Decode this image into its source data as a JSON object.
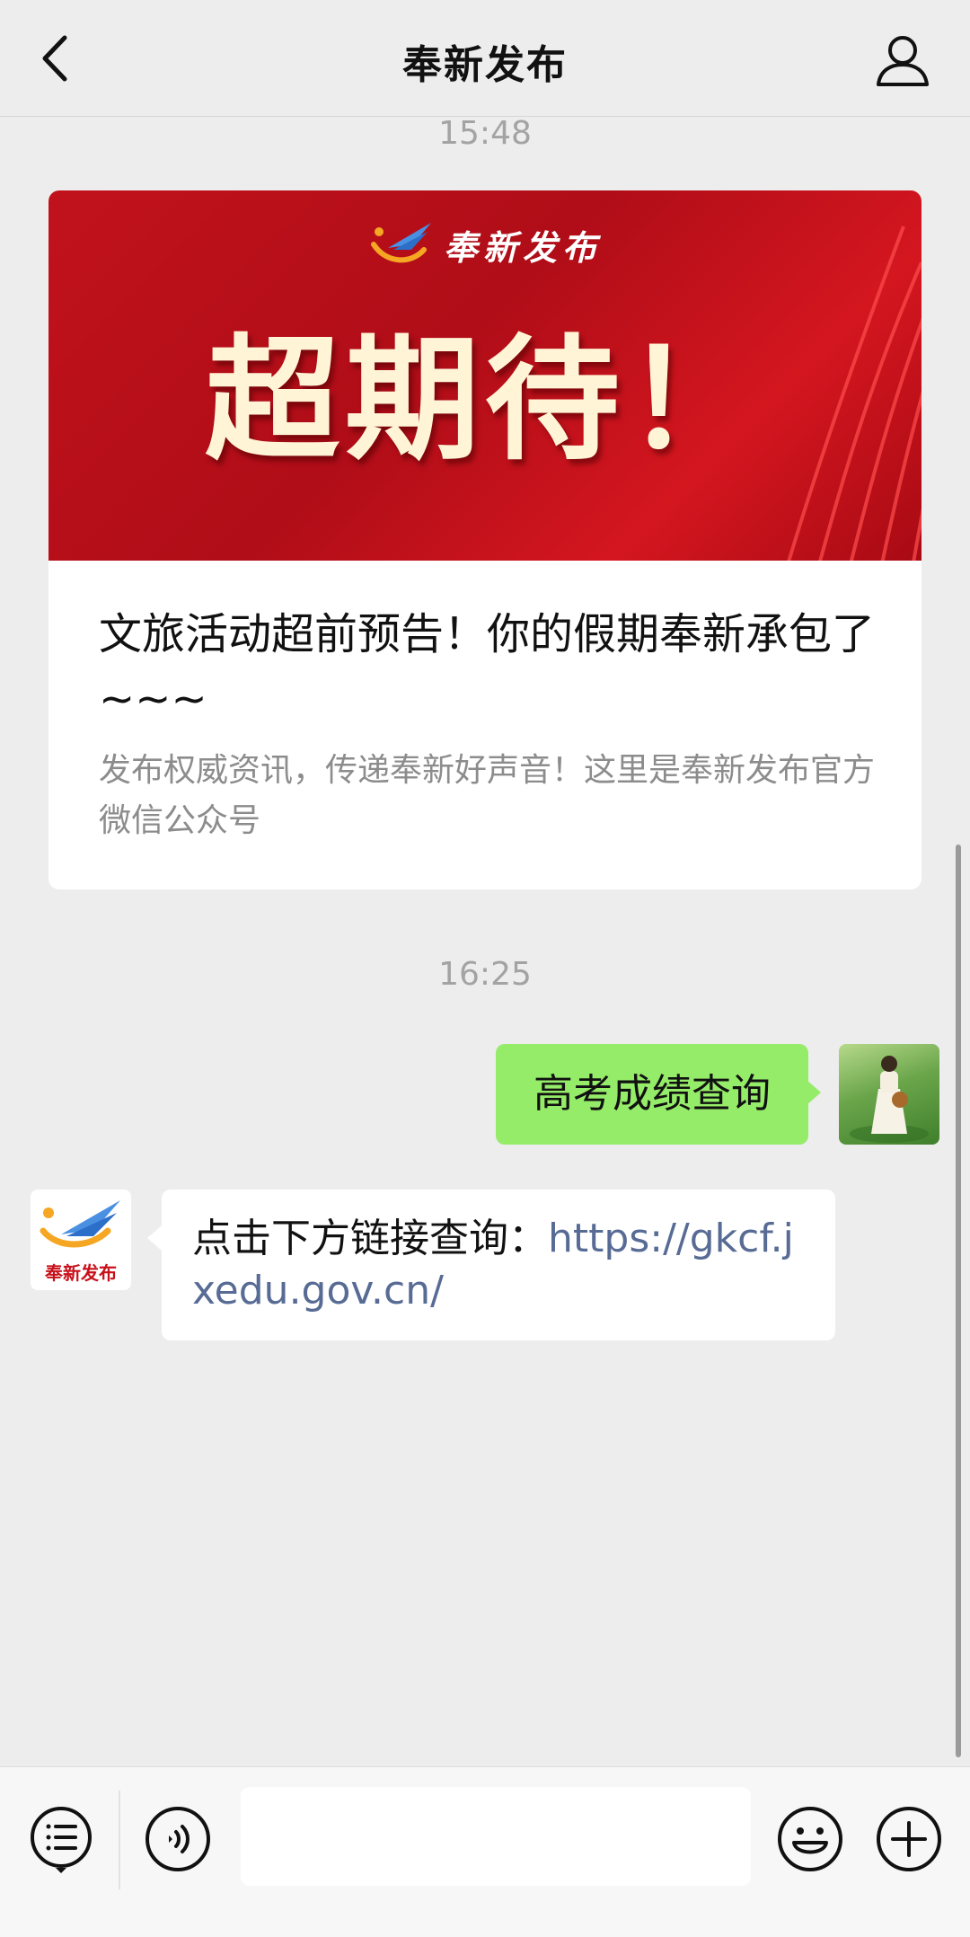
{
  "header": {
    "title": "奉新发布"
  },
  "messages": {
    "time_1": "15:48",
    "time_2": "16:25",
    "article": {
      "banner_brand": "奉新发布",
      "banner_headline": "超期待！",
      "title": "文旅活动超前预告！你的假期奉新承包了~~~",
      "description": "发布权威资讯，传递奉新好声音！这里是奉新发布官方微信公众号"
    },
    "sent": {
      "text": "高考成绩查询"
    },
    "received": {
      "text": "点击下方链接查询：",
      "link": "https://gkcf.jxedu.gov.cn/",
      "avatar_text": "奉新发布"
    }
  },
  "toolbar": {
    "input_value": ""
  },
  "colors": {
    "background": "#ededed",
    "sent_bubble": "#95ec69",
    "link": "#576b95",
    "banner_red": "#c1121c"
  },
  "icons": [
    "back-icon",
    "profile-icon",
    "menu-list-icon",
    "voice-icon",
    "emoji-icon",
    "plus-icon"
  ]
}
